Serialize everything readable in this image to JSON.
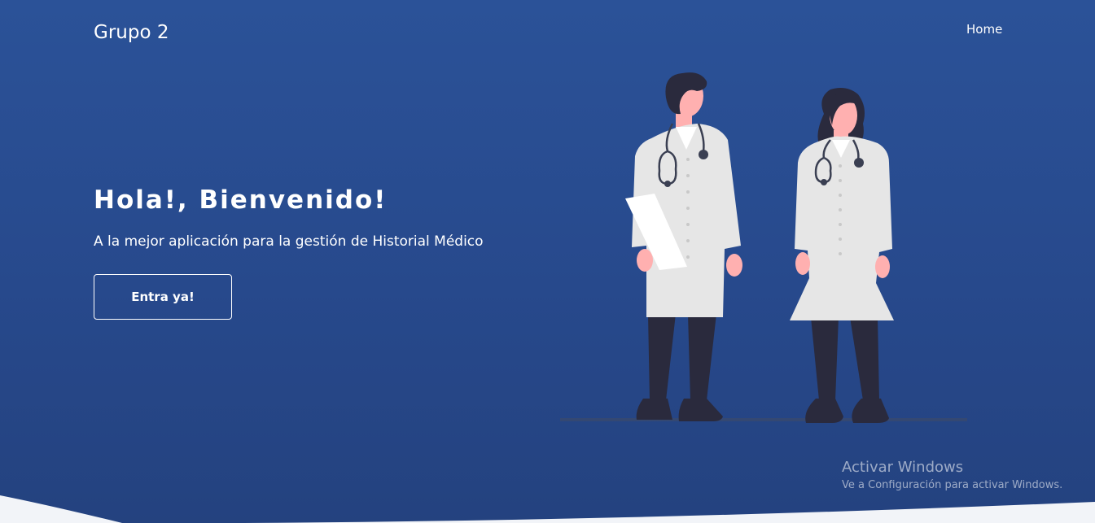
{
  "navbar": {
    "brand": "Grupo 2",
    "links": [
      {
        "label": "Home"
      }
    ]
  },
  "hero": {
    "title": "Hola!, Bienvenido!",
    "subtitle": "A la mejor aplicación para la gestión de Historial Médico",
    "cta_label": "Entra ya!"
  },
  "illustration": {
    "subject": "two-doctors-icon"
  },
  "windows_watermark": {
    "title": "Activar Windows",
    "subtitle": "Ve a Configuración para activar Windows."
  },
  "colors": {
    "background": "#2b5298",
    "background_bottom": "#24427f",
    "text": "#ffffff",
    "coat": "#e6e6e6",
    "dark": "#2a2a3d",
    "skin": "#ffb0b0"
  }
}
